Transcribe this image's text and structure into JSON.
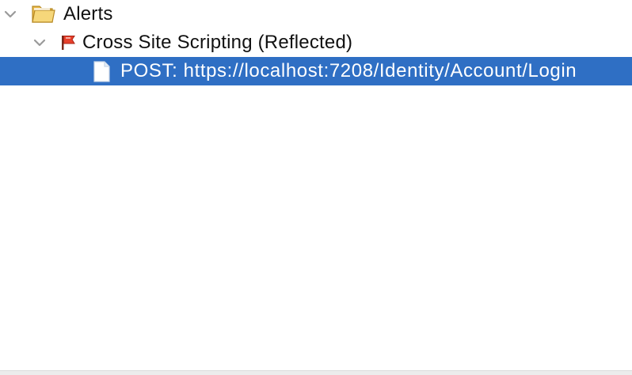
{
  "tree": {
    "root": {
      "label": "Alerts",
      "expanded": true,
      "icon": "folder-open-icon"
    },
    "alert": {
      "label": "Cross Site Scripting (Reflected)",
      "expanded": true,
      "icon": "red-flag-icon",
      "flag_color": "#e8402b"
    },
    "instance": {
      "label": "POST: https://localhost:7208/Identity/Account/Login",
      "selected": true,
      "icon": "document-icon"
    }
  },
  "colors": {
    "selection": "#2f6fc4",
    "folder": "#f3cf6b",
    "chevron": "#9a9a9a"
  }
}
